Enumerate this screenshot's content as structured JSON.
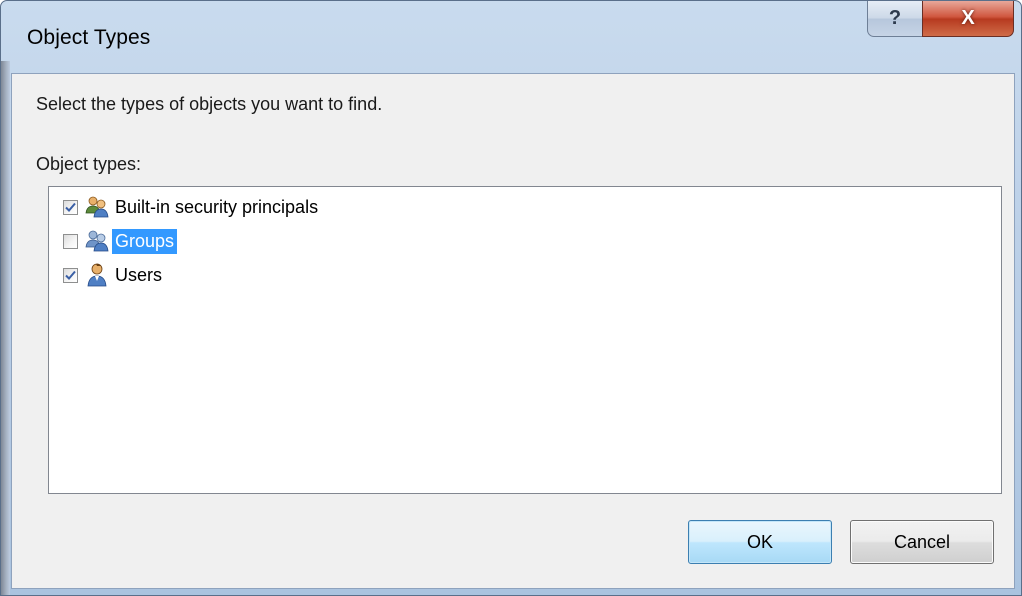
{
  "window": {
    "title": "Object Types",
    "help_glyph": "?",
    "close_glyph": "X"
  },
  "dialog": {
    "prompt": "Select the types of objects you want to find.",
    "list_label": "Object types:",
    "items": [
      {
        "label": "Built-in security principals",
        "checked": true,
        "selected": false,
        "icon": "group-users-icon"
      },
      {
        "label": "Groups",
        "checked": false,
        "selected": true,
        "icon": "group-users-icon"
      },
      {
        "label": "Users",
        "checked": true,
        "selected": false,
        "icon": "user-icon"
      }
    ],
    "ok_label": "OK",
    "cancel_label": "Cancel"
  },
  "colors": {
    "selection": "#3399ff",
    "close_button": "#c8462b",
    "dialog_background": "#f0f0f0"
  }
}
